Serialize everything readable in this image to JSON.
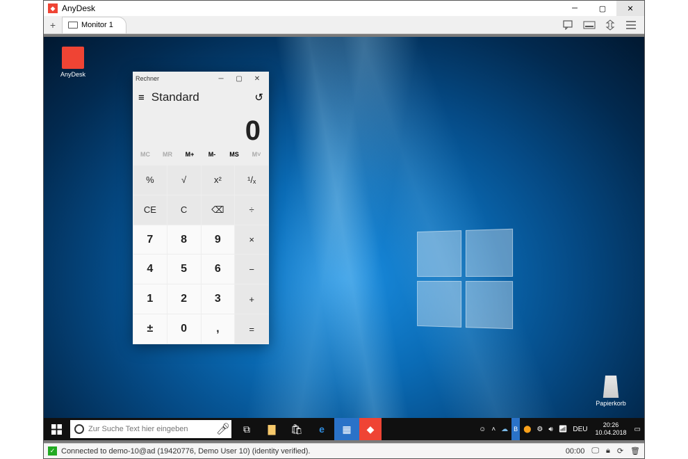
{
  "app": {
    "title": "AnyDesk"
  },
  "tab": {
    "label": "Monitor 1"
  },
  "desktop_icons": {
    "anydesk": "AnyDesk",
    "papierkorb": "Papierkorb"
  },
  "calculator": {
    "title": "Rechner",
    "mode": "Standard",
    "display": "0",
    "memory": [
      "MC",
      "MR",
      "M+",
      "M-",
      "MS",
      "M˅"
    ],
    "buttons": [
      "%",
      "√",
      "x²",
      "¹/ₓ",
      "CE",
      "C",
      "⌫",
      "÷",
      "7",
      "8",
      "9",
      "×",
      "4",
      "5",
      "6",
      "−",
      "1",
      "2",
      "3",
      "+",
      "±",
      "0",
      ",",
      "="
    ]
  },
  "taskbar": {
    "search_placeholder": "Zur Suche Text hier eingeben",
    "lang": "DEU",
    "time": "20:26",
    "date": "10.04.2018"
  },
  "statusbar": {
    "text": "Connected to demo-10@ad (19420776, Demo User 10) (identity verified).",
    "timer": "00:00"
  }
}
